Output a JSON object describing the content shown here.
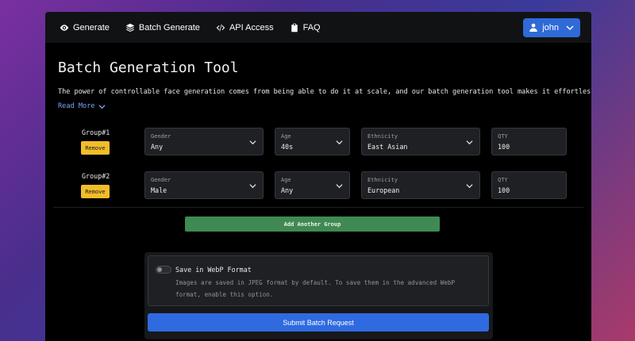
{
  "nav": {
    "items": [
      {
        "label": "Generate",
        "icon": "eye-icon"
      },
      {
        "label": "Batch Generate",
        "icon": "layers-icon"
      },
      {
        "label": "API Access",
        "icon": "code-icon"
      },
      {
        "label": "FAQ",
        "icon": "clipboard-icon"
      }
    ],
    "user": "john"
  },
  "page": {
    "title": "Batch Generation Tool",
    "description": "The power of controllable face generation comes from being able to do it at scale, and our batch generation tool makes it effortless.",
    "read_more": "Read More"
  },
  "groups": [
    {
      "label": "Group#1",
      "remove": "Remove",
      "gender": {
        "label": "Gender",
        "value": "Any"
      },
      "age": {
        "label": "Age",
        "value": "40s"
      },
      "ethnicity": {
        "label": "Ethnicity",
        "value": "East Asian"
      },
      "qty": {
        "label": "QTY",
        "value": "100"
      }
    },
    {
      "label": "Group#2",
      "remove": "Remove",
      "gender": {
        "label": "Gender",
        "value": "Male"
      },
      "age": {
        "label": "Age",
        "value": "Any"
      },
      "ethnicity": {
        "label": "Ethnicity",
        "value": "European"
      },
      "qty": {
        "label": "QTY",
        "value": "100"
      }
    }
  ],
  "add_group": "Add Another Group",
  "webp": {
    "title": "Save in WebP Format",
    "description": "Images are saved in JPEG format by default. To save them in the advanced WebP format, enable this option.",
    "enabled": false
  },
  "submit": "Submit Batch Request",
  "colors": {
    "accent": "#2f6ae0",
    "remove": "#f2bd2a",
    "add": "#3f8a52",
    "link": "#7aa7f5"
  }
}
